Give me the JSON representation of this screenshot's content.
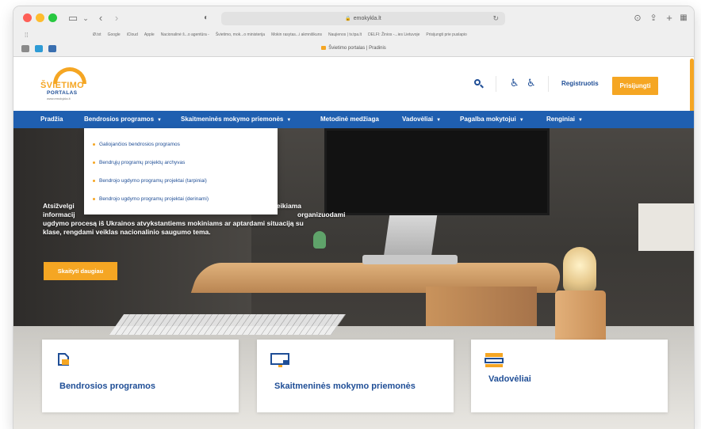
{
  "browser": {
    "address": "emokykla.lt",
    "tab_title": "Švietimo portalas | Pradinis",
    "bookmarks": [
      "Ø.txt",
      "Google",
      "iCloud",
      "Apple",
      "Nacionalinė š...o agentūra -",
      "Švietimo, mok...o ministerija",
      "Mokin rasytas...i akmniškuns",
      "Naujienos | tv.tpa.lt",
      "DELFI: Žinios -...ies Lietuvoje",
      "Prisijungti prie puslapio"
    ]
  },
  "site": {
    "logo_main": "ŠVIETIMO",
    "logo_sub": "PORTALAS",
    "logo_url": "www.emokykla.lt",
    "register_label": "Registruotis",
    "login_label": "Prisijungti"
  },
  "nav": {
    "items": [
      {
        "label": "Pradžia",
        "caret": ""
      },
      {
        "label": "Bendrosios programos",
        "caret": "▼"
      },
      {
        "label": "Skaitmeninės mokymo priemonės",
        "caret": "▼"
      },
      {
        "label": "Metodinė medžiaga",
        "caret": ""
      },
      {
        "label": "Vadovėliai",
        "caret": "▼"
      },
      {
        "label": "Pagalba mokytojui",
        "caret": "▼"
      },
      {
        "label": "Renginiai",
        "caret": "▼"
      }
    ]
  },
  "dropdown": {
    "items": [
      "Galiojančios bendrosios programos",
      "Bendrųjų programų projektų archyvas",
      "Bendrojo ugdymo programų projektai (tarpiniai)",
      "Bendrojo ugdymo programų projektai (derinami)"
    ]
  },
  "hero": {
    "text_left": "Atsižvelgi",
    "text_line2": "informacij",
    "text_line3": "ugdymo procesą iš Ukrainos atvykstantiems mokiniams ar aptardami situaciją su",
    "text_line4": "klase, rengdami veiklas nacionalinio saugumo tema.",
    "text_right1": "e pateikiama",
    "text_right2": "organizuodami",
    "button_label": "Skaityti daugiau"
  },
  "cards": [
    {
      "title": "Bendrosios programos",
      "icon": "document-icon"
    },
    {
      "title": "Skaitmeninės mokymo priemonės",
      "icon": "monitor-icon"
    },
    {
      "title": "Vadovėliai",
      "icon": "books-icon"
    }
  ],
  "colors": {
    "brand_blue": "#1f5fb0",
    "text_blue": "#1f4e96",
    "accent_orange": "#f5a623"
  }
}
